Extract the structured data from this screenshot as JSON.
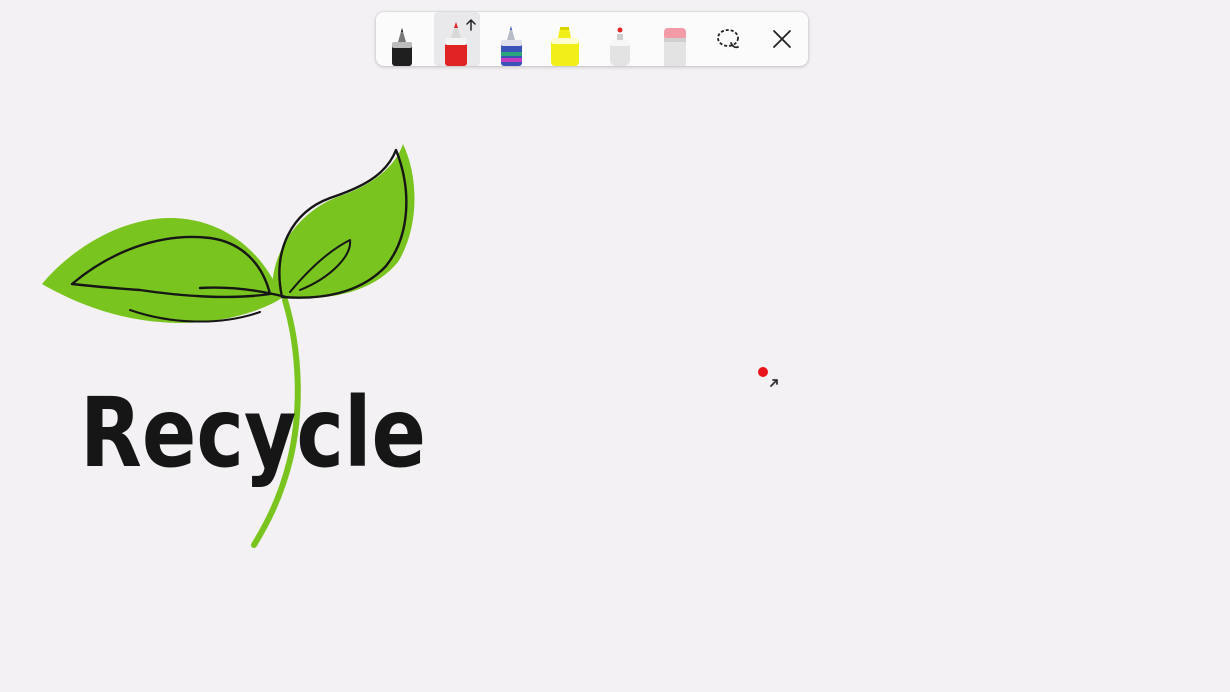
{
  "toolbar": {
    "tools": [
      {
        "name": "pen",
        "color": "#1f1f1f",
        "selected": false
      },
      {
        "name": "pen",
        "color": "#e02424",
        "selected": true
      },
      {
        "name": "galaxy-pen",
        "color": "#3b53b8",
        "selected": false
      },
      {
        "name": "highlighter",
        "color": "#f1ee1a",
        "selected": false
      },
      {
        "name": "laser-pointer",
        "color": "#e02424",
        "selected": false
      },
      {
        "name": "eraser",
        "color": "#f29aa6",
        "selected": false
      }
    ],
    "lasso_icon": "lasso-select-icon",
    "close_icon": "close-icon"
  },
  "drawing": {
    "handwritten_text": "Recycle",
    "leaf_color": "#79c41e",
    "stroke_color": "#161616"
  },
  "pointer": {
    "dot_color": "#e8141c"
  }
}
